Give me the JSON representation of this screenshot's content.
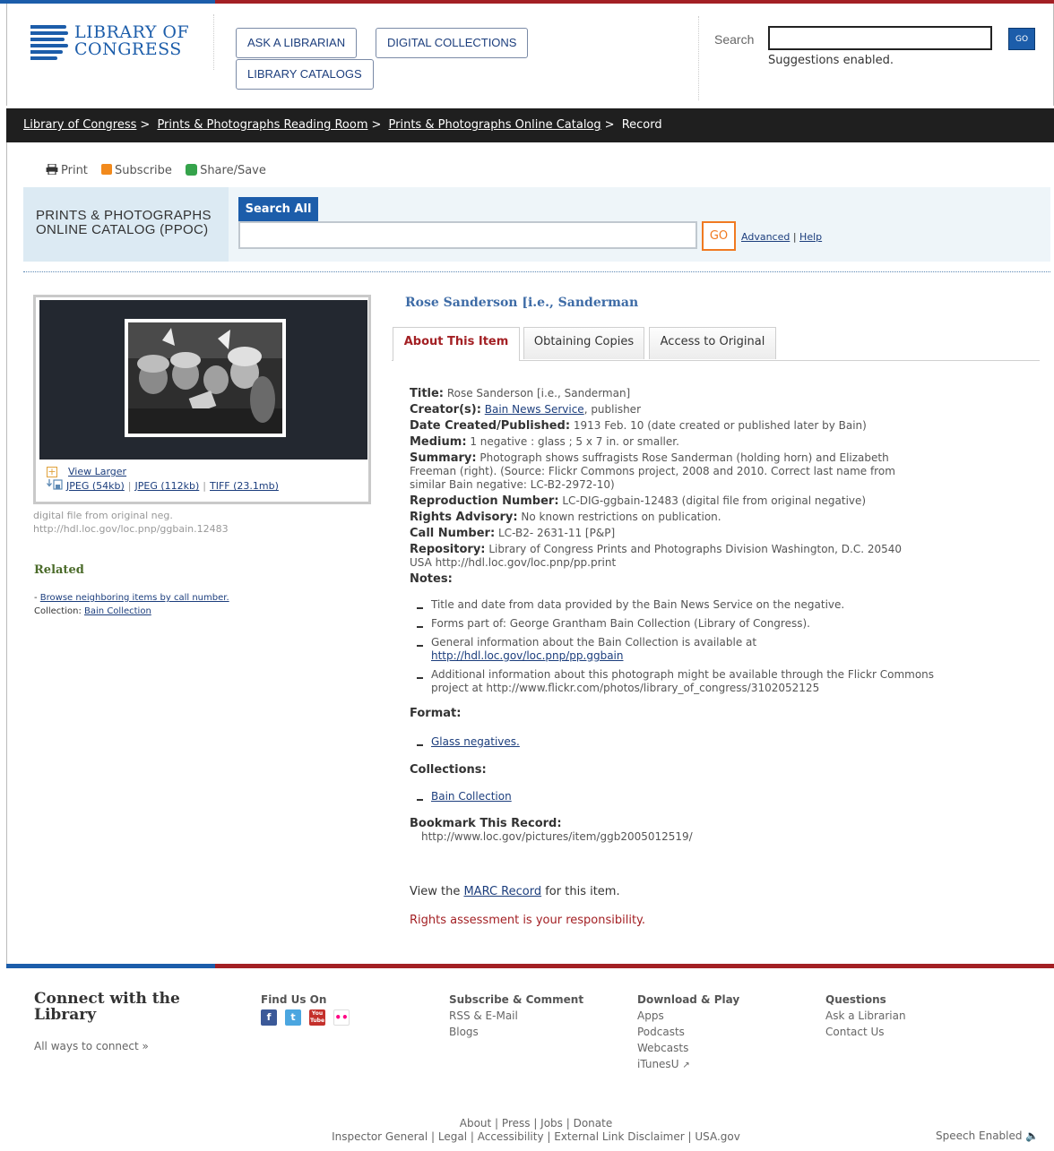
{
  "header": {
    "logo_line1": "LIBRARY OF",
    "logo_line2": "CONGRESS",
    "nav": [
      "ASK A LIBRARIAN",
      "DIGITAL COLLECTIONS",
      "LIBRARY CATALOGS"
    ],
    "search_label": "Search",
    "search_go": "GO",
    "suggestions": "Suggestions enabled."
  },
  "breadcrumb": {
    "items": [
      "Library of Congress",
      "Prints & Photographs Reading Room",
      "Prints & Photographs Online Catalog"
    ],
    "current": "Record",
    "separator": ">"
  },
  "share": {
    "print": "Print",
    "subscribe": "Subscribe",
    "share_save": "Share/Save"
  },
  "ppoc": {
    "title_line1": "PRINTS & PHOTOGRAPHS",
    "title_line2": "ONLINE CATALOG (PPOC)",
    "tab": "Search All",
    "go": "GO",
    "advanced": "Advanced",
    "help": "Help"
  },
  "image": {
    "view_larger": "View Larger",
    "downloads": [
      "JPEG (54kb)",
      "JPEG (112kb)",
      "TIFF (23.1mb)"
    ],
    "caption_line1": "digital file from original neg.",
    "caption_line2": "http://hdl.loc.gov/loc.pnp/ggbain.12483"
  },
  "related": {
    "heading": "Related",
    "browse": "Browse neighboring items by call number.",
    "collection_label": "Collection:",
    "collection": "Bain Collection"
  },
  "record": {
    "title": "Rose Sanderson [i.e., Sanderman",
    "tabs": [
      "About This Item",
      "Obtaining Copies",
      "Access to Original"
    ],
    "fields": {
      "title_label": "Title:",
      "title_value": "Rose Sanderson [i.e., Sanderman]",
      "creator_label": "Creator(s):",
      "creator_link": "Bain News Service",
      "creator_suffix": ", publisher",
      "date_label": "Date Created/Published:",
      "date_value": "1913 Feb. 10 (date created or published later by Bain)",
      "medium_label": "Medium:",
      "medium_value": "1 negative : glass ; 5 x 7 in. or smaller.",
      "summary_label": "Summary:",
      "summary_value": "Photograph shows suffragists Rose Sanderman (holding horn) and Elizabeth Freeman (right). (Source: Flickr Commons project, 2008 and 2010. Correct last name from similar Bain negative: LC-B2-2972-10)",
      "repro_label": "Reproduction Number:",
      "repro_value": "LC-DIG-ggbain-12483 (digital file from original negative)",
      "rights_label": "Rights Advisory:",
      "rights_value": "No known restrictions on publication.",
      "call_label": "Call Number:",
      "call_value": "LC-B2- 2631-11 [P&P]",
      "repo_label": "Repository:",
      "repo_value": "Library of Congress Prints and Photographs Division Washington, D.C. 20540 USA http://hdl.loc.gov/loc.pnp/pp.print",
      "notes_label": "Notes:"
    },
    "notes": [
      "Title and date from data provided by the Bain News Service on the negative.",
      "Forms part of: George Grantham Bain Collection (Library of Congress).",
      "General information about the Bain Collection is available at",
      "http://hdl.loc.gov/loc.pnp/pp.ggbain",
      "Additional information about this photograph might be available through the Flickr Commons project at http://www.flickr.com/photos/library_of_congress/3102052125"
    ],
    "format_label": "Format:",
    "format_value": "Glass negatives.",
    "collections_label": "Collections:",
    "collections_value": "Bain Collection",
    "bookmark_label": "Bookmark This Record:",
    "bookmark_url": "http://www.loc.gov/pictures/item/ggb2005012519/",
    "marc_prefix": "View the",
    "marc_link": "MARC Record",
    "marc_suffix": "for this item.",
    "rights_note": "Rights assessment is your responsibility."
  },
  "footer": {
    "connect_heading": "Connect with the Library",
    "connect_link": "All ways to connect »",
    "find_us": "Find Us On",
    "social": [
      "f",
      "t",
      "You Tube",
      "••"
    ],
    "subscribe_h": "Subscribe & Comment",
    "subscribe_items": [
      "RSS & E-Mail",
      "Blogs"
    ],
    "download_h": "Download & Play",
    "download_items": [
      "Apps",
      "Podcasts",
      "Webcasts",
      "iTunesU"
    ],
    "questions_h": "Questions",
    "questions_items": [
      "Ask a Librarian",
      "Contact Us"
    ],
    "bottom_line1": "About | Press | Jobs | Donate",
    "bottom_line2": "Inspector General | Legal | Accessibility | External Link Disclaimer | USA.gov",
    "speech": "Speech Enabled"
  },
  "colors": {
    "loc_blue": "#1c5daa",
    "loc_red": "#a32024",
    "accent_orange": "#f07a22"
  }
}
